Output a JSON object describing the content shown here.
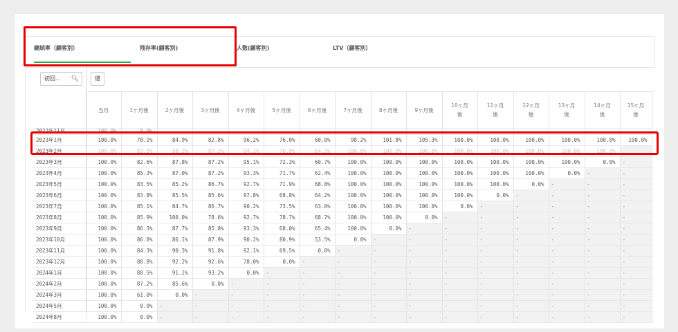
{
  "tabs": [
    {
      "label": "継続率（顧客別）",
      "active": true
    },
    {
      "label": "残存率(顧客別)",
      "active": false
    },
    {
      "label": "人数(顧客別)",
      "active": false
    },
    {
      "label": "LTV（顧客別）",
      "active": false
    }
  ],
  "search": {
    "placeholder": "初回..."
  },
  "value_button": "値",
  "accent_color": "#2ea44f",
  "highlight_color": "#e60000",
  "columns": [
    "当月",
    "1ヶ月後",
    "2ヶ月後",
    "3ヶ月後",
    "4ヶ月後",
    "5ヶ月後",
    "6ヶ月後",
    "7ヶ月後",
    "8ヶ月後",
    "9ヶ月後",
    "10ヶ月後",
    "11ヶ月後",
    "12ヶ月後",
    "13ヶ月後",
    "14ヶ月後",
    "15ヶ月後"
  ],
  "rows": [
    {
      "label": "2022年11月",
      "values": [
        "100.0%",
        "0.0%"
      ],
      "partial": true
    },
    {
      "label": "2023年1月",
      "values": [
        "100.0%",
        "78.1%",
        "84.9%",
        "82.8%",
        "96.2%",
        "76.0%",
        "60.0%",
        "98.2%",
        "101.8%",
        "105.3%",
        "100.0%",
        "100.0%",
        "100.0%",
        "100.0%",
        "100.0%",
        "100.0%"
      ],
      "highlight": true
    },
    {
      "label": "2023年2月",
      "values": [
        "100.0%",
        "83.5%",
        "88.2%",
        "87.2%",
        "94.2%",
        "70.8%",
        "64.3%",
        "100.0%",
        "100.0%",
        "100.0%",
        "100.0%",
        "100.0%",
        "100.0%",
        "100.0%",
        "100.0%"
      ],
      "obscured": true
    },
    {
      "label": "2023年3月",
      "values": [
        "100.0%",
        "82.6%",
        "87.8%",
        "87.2%",
        "95.1%",
        "72.3%",
        "60.7%",
        "100.0%",
        "100.0%",
        "100.0%",
        "100.0%",
        "100.0%",
        "100.0%",
        "100.0%",
        "0.0%",
        "-"
      ]
    },
    {
      "label": "2023年4月",
      "values": [
        "100.0%",
        "85.3%",
        "87.0%",
        "87.2%",
        "93.3%",
        "71.7%",
        "62.4%",
        "100.0%",
        "100.0%",
        "100.0%",
        "100.0%",
        "100.0%",
        "100.0%",
        "0.0%",
        "-",
        "-"
      ]
    },
    {
      "label": "2023年5月",
      "values": [
        "100.0%",
        "83.5%",
        "85.2%",
        "86.7%",
        "92.7%",
        "71.9%",
        "68.8%",
        "100.0%",
        "100.0%",
        "100.0%",
        "100.0%",
        "100.0%",
        "0.0%",
        "-",
        "-",
        "-"
      ]
    },
    {
      "label": "2023年6月",
      "values": [
        "100.0%",
        "83.8%",
        "85.5%",
        "85.6%",
        "97.8%",
        "68.8%",
        "64.2%",
        "100.0%",
        "100.0%",
        "100.0%",
        "100.0%",
        "0.0%",
        "-",
        "-",
        "-",
        "-"
      ]
    },
    {
      "label": "2023年7月",
      "values": [
        "100.0%",
        "85.1%",
        "84.7%",
        "86.7%",
        "90.2%",
        "73.5%",
        "63.0%",
        "100.0%",
        "100.0%",
        "100.0%",
        "0.0%",
        "-",
        "-",
        "-",
        "-",
        "-"
      ]
    },
    {
      "label": "2023年8月",
      "values": [
        "100.0%",
        "85.9%",
        "100.0%",
        "78.6%",
        "92.7%",
        "78.7%",
        "68.7%",
        "100.0%",
        "100.0%",
        "0.0%",
        "-",
        "-",
        "-",
        "-",
        "-",
        "-"
      ]
    },
    {
      "label": "2023年9月",
      "values": [
        "100.0%",
        "86.3%",
        "87.7%",
        "85.8%",
        "93.3%",
        "68.0%",
        "65.4%",
        "100.0%",
        "0.0%",
        "-",
        "-",
        "-",
        "-",
        "-",
        "-",
        "-"
      ]
    },
    {
      "label": "2023年10月",
      "values": [
        "100.0%",
        "86.8%",
        "86.1%",
        "87.9%",
        "90.2%",
        "80.9%",
        "53.5%",
        "0.0%",
        "-",
        "-",
        "-",
        "-",
        "-",
        "-",
        "-",
        "-"
      ]
    },
    {
      "label": "2023年11月",
      "values": [
        "100.0%",
        "84.3%",
        "90.3%",
        "91.8%",
        "92.1%",
        "69.5%",
        "0.0%",
        "-",
        "-",
        "-",
        "-",
        "-",
        "-",
        "-",
        "-",
        "-"
      ]
    },
    {
      "label": "2023年12月",
      "values": [
        "100.0%",
        "88.8%",
        "92.2%",
        "92.6%",
        "78.0%",
        "0.0%",
        "-",
        "-",
        "-",
        "-",
        "-",
        "-",
        "-",
        "-",
        "-",
        "-"
      ]
    },
    {
      "label": "2024年1月",
      "values": [
        "100.0%",
        "88.5%",
        "91.1%",
        "93.2%",
        "0.0%",
        "-",
        "-",
        "-",
        "-",
        "-",
        "-",
        "-",
        "-",
        "-",
        "-",
        "-"
      ]
    },
    {
      "label": "2024年2月",
      "values": [
        "100.0%",
        "87.2%",
        "85.6%",
        "0.0%",
        "-",
        "-",
        "-",
        "-",
        "-",
        "-",
        "-",
        "-",
        "-",
        "-",
        "-",
        "-"
      ]
    },
    {
      "label": "2024年3月",
      "values": [
        "100.0%",
        "61.0%",
        "0.0%",
        "-",
        "-",
        "-",
        "-",
        "-",
        "-",
        "-",
        "-",
        "-",
        "-",
        "-",
        "-",
        "-"
      ]
    },
    {
      "label": "2024年5月",
      "values": [
        "100.0%",
        "0.0%",
        "-",
        "-",
        "-",
        "-",
        "-",
        "-",
        "-",
        "-",
        "-",
        "-",
        "-",
        "-",
        "-",
        "-"
      ]
    },
    {
      "label": "2024年8月",
      "values": [
        "100.0%",
        "0.0%",
        "-",
        "-",
        "-",
        "-",
        "-",
        "-",
        "-",
        "-",
        "-",
        "-",
        "-",
        "-",
        "-",
        "-"
      ]
    }
  ]
}
